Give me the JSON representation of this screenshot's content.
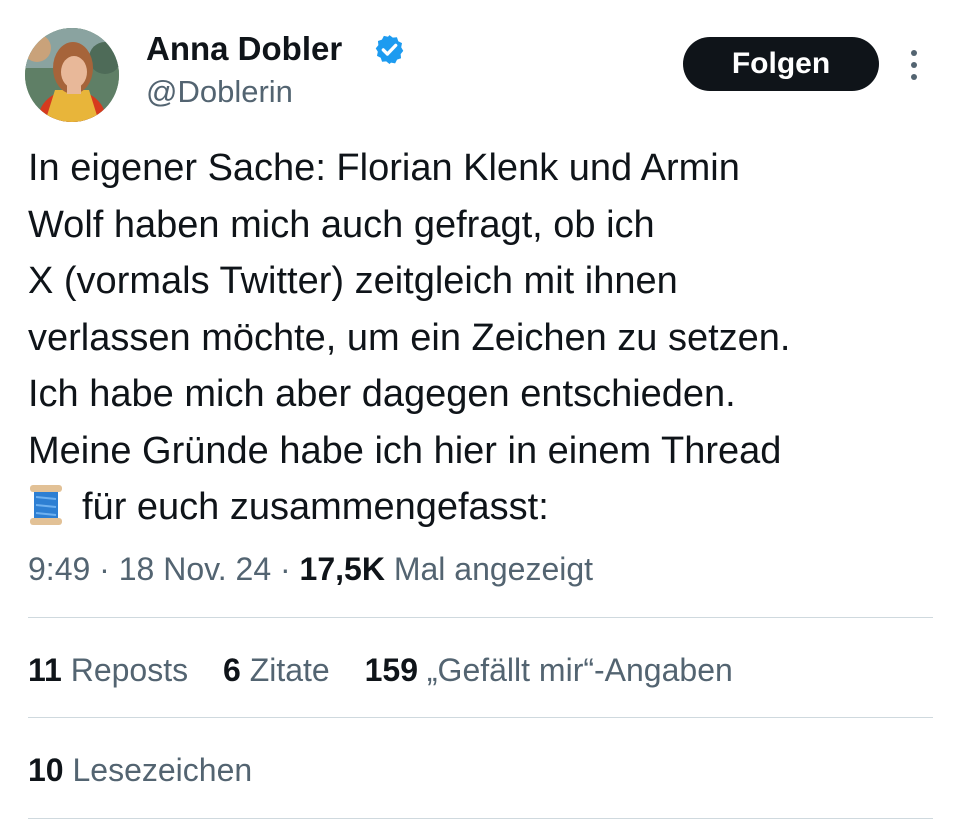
{
  "author": {
    "name": "Anna Dobler",
    "handle": "@Doblerin",
    "verified": true
  },
  "actions": {
    "follow_label": "Folgen"
  },
  "tweet": {
    "lines": [
      "In eigener Sache: Florian Klenk und Armin",
      "Wolf haben mich auch gefragt, ob ich",
      "X (vormals Twitter) zeitgleich mit ihnen",
      "verlassen möchte, um ein Zeichen zu setzen.",
      "Ich habe mich aber dagegen entschieden.",
      "Meine Gründe habe ich hier in einem Thread",
      "für euch zusammengefasst:"
    ],
    "emoji_icon": "spool-of-thread-icon"
  },
  "meta": {
    "time": "9:49",
    "date": "18 Nov. 24",
    "separator": "·",
    "views_count": "17,5K",
    "views_label": "Mal angezeigt"
  },
  "stats": {
    "reposts_count": "11",
    "reposts_label": "Reposts",
    "quotes_count": "6",
    "quotes_label": "Zitate",
    "likes_count": "159",
    "likes_label": "„Gefällt mir“-Angaben",
    "bookmarks_count": "10",
    "bookmarks_label": "Lesezeichen"
  },
  "colors": {
    "text": "#0f1419",
    "secondary": "#536471",
    "verified_blue": "#1d9bf0",
    "divider": "#cfd9de"
  }
}
